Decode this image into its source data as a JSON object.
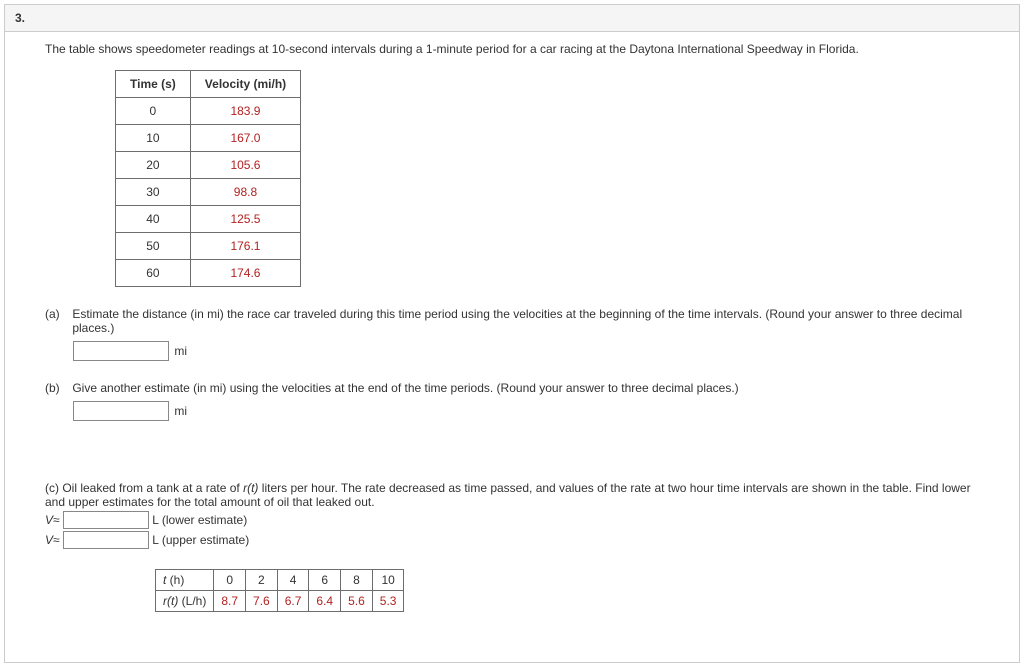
{
  "question_number": "3.",
  "intro": "The table shows speedometer readings at 10-second intervals during a 1-minute period for a car racing at the Daytona International Speedway in Florida.",
  "velocity_table": {
    "headers": [
      "Time (s)",
      "Velocity (mi/h)"
    ],
    "rows": [
      {
        "time": "0",
        "velocity": "183.9"
      },
      {
        "time": "10",
        "velocity": "167.0"
      },
      {
        "time": "20",
        "velocity": "105.6"
      },
      {
        "time": "30",
        "velocity": "98.8"
      },
      {
        "time": "40",
        "velocity": "125.5"
      },
      {
        "time": "50",
        "velocity": "176.1"
      },
      {
        "time": "60",
        "velocity": "174.6"
      }
    ]
  },
  "parts": {
    "a": {
      "label": "(a)",
      "text": "Estimate the distance (in mi) the race car traveled during this time period using the velocities at the beginning of the time intervals. (Round your answer to three decimal places.)",
      "unit": "mi"
    },
    "b": {
      "label": "(b)",
      "text": "Give another estimate (in mi) using the velocities at the end of the time periods. (Round your answer to three decimal places.)",
      "unit": "mi"
    },
    "c": {
      "label": "(c)",
      "text_before": "Oil leaked from a tank at a rate of ",
      "rt": "r(t)",
      "text_after": " liters per hour. The rate decreased as time passed, and values of the rate at two hour time intervals are shown in the table. Find lower and upper estimates for the total amount of oil that leaked out.",
      "v_symbol": "V",
      "approx": "≈",
      "lower_label": "L (lower estimate)",
      "upper_label": "L (upper estimate)"
    }
  },
  "oil_table": {
    "row1_label": "t",
    "row1_unit": " (h)",
    "row2_label": "r(t)",
    "row2_unit": " (L/h)",
    "times": [
      "0",
      "2",
      "4",
      "6",
      "8",
      "10"
    ],
    "rates": [
      "8.7",
      "7.6",
      "6.7",
      "6.4",
      "5.6",
      "5.3"
    ]
  },
  "chart_data": [
    {
      "type": "table",
      "title": "Speedometer readings",
      "x": [
        0,
        10,
        20,
        30,
        40,
        50,
        60
      ],
      "y": [
        183.9,
        167.0,
        105.6,
        98.8,
        125.5,
        176.1,
        174.6
      ],
      "xlabel": "Time (s)",
      "ylabel": "Velocity (mi/h)"
    },
    {
      "type": "table",
      "title": "Oil leak rate",
      "x": [
        0,
        2,
        4,
        6,
        8,
        10
      ],
      "y": [
        8.7,
        7.6,
        6.7,
        6.4,
        5.6,
        5.3
      ],
      "xlabel": "t (h)",
      "ylabel": "r(t) (L/h)"
    }
  ]
}
